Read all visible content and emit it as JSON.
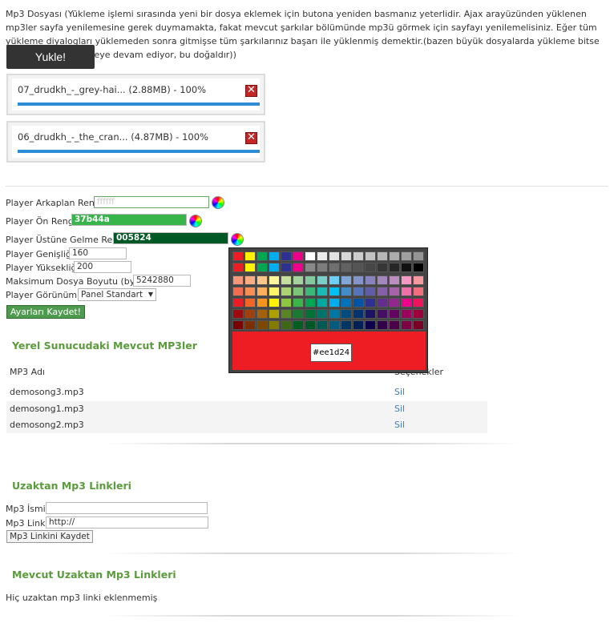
{
  "upload": {
    "description": "Mp3 Dosyası (Yükleme işlemi sırasında yeni bir dosya eklemek için butona yeniden basmanız yeterlidir. Ajax arayüzünden yüklenen mp3ler sayfa yenilemesine gerek duymamakta, fakat mevcut şarkılar bölümünde mp3ü görmek için sayfayı yenilemelisiniz. Eğer tüm yükleme diyalogları yüklemeden sonra gitmişse tüm şarkılarınız başarı ile yüklenmiş demektir.(bazen büyük dosyalarda yükleme bitse bile diyalog gözükmeye devam ediyor, bu doğaldır))",
    "button_label": "Yukle!",
    "files": [
      {
        "name": "07_drudkh_-_grey-hai... (2.88MB) - 100%",
        "progress": 1.0
      },
      {
        "name": "06_drudkh_-_the_cran... (4.87MB) - 100%",
        "progress": 1.0
      }
    ]
  },
  "settings": {
    "bg_color_label": "Player Arkaplan Rengi:",
    "bg_color_value": "ffffff",
    "fg_color_label": "Player Ön Rengi:",
    "fg_color_value": "37b44a",
    "hover_color_label": "Player Üstüne Gelme Rengi:",
    "hover_color_value": "005824",
    "width_label": "Player Genişliği:",
    "width_value": "160",
    "height_label": "Player Yüksekliği:",
    "height_value": "200",
    "max_size_label": "Maksimum Dosya Boyutu (byte):",
    "max_size_value": "5242880",
    "view_label": "Player Görünümü:",
    "view_value": "Panel Standart",
    "save_label": "Ayarları Kaydet!"
  },
  "colors": {
    "fg_bg": "#37b44a",
    "hover_bg": "#005824",
    "accent_green": "#5a9b3c",
    "link_blue": "#3a7fc8"
  },
  "local": {
    "title": "Yerel Sunucudaki Mevcut MP3ler",
    "col_name": "MP3 Adı",
    "col_actions": "Seçenekler",
    "rows": [
      {
        "name": "demosong3.mp3",
        "action": "Sil"
      },
      {
        "name": "demosong1.mp3",
        "action": "Sil"
      },
      {
        "name": "demosong2.mp3",
        "action": "Sil"
      }
    ]
  },
  "remote": {
    "title": "Uzaktan Mp3 Linkleri",
    "name_label": "Mp3 İsmi:",
    "name_value": "",
    "link_label": "Mp3 Linki:",
    "link_value": "http://",
    "save_label": "Mp3 Linkini Kaydet"
  },
  "existing_remote": {
    "title": "Mevcut Uzaktan Mp3 Linkleri",
    "empty_text": "Hiç uzaktan mp3 linki eklenmemiş"
  },
  "picker": {
    "selected_hex": "#ee1d24",
    "top_row": [
      "#ee1d24",
      "#fff200",
      "#00a650",
      "#00aeef",
      "#2f3192",
      "#ed008c",
      "#ffffff",
      "#ebebeb",
      "#e1e1e1",
      "#d7d7d7",
      "#cccccc",
      "#c2c2c2",
      "#b7b7b7",
      "#acacac",
      "#a0a0a0",
      "#959595"
    ],
    "second_row": [
      "#ee1d24",
      "#fff200",
      "#00a650",
      "#00aeef",
      "#2f3192",
      "#ed008c",
      "#898989",
      "#7d7d7d",
      "#707070",
      "#626262",
      "#555555",
      "#464646",
      "#363636",
      "#262626",
      "#111111",
      "#000000"
    ],
    "grid": [
      [
        "#f7977a",
        "#f9ad81",
        "#fdc68a",
        "#fff79a",
        "#c4df9b",
        "#a2d39c",
        "#82ca9d",
        "#7bcdc8",
        "#6ecff6",
        "#7ea7d8",
        "#8493ca",
        "#8882be",
        "#a187be",
        "#bc8dbf",
        "#f49ac2",
        "#f6989d"
      ],
      [
        "#f26c4f",
        "#f68e55",
        "#fbaf5c",
        "#fff467",
        "#acd372",
        "#7cc576",
        "#3bb878",
        "#1abbb4",
        "#00bff3",
        "#438cca",
        "#5574b9",
        "#605ca8",
        "#855fa8",
        "#a763a8",
        "#f06ea9",
        "#f26d7d"
      ],
      [
        "#ed1c24",
        "#f26522",
        "#f7941d",
        "#fff200",
        "#8dc73f",
        "#39b54a",
        "#00a651",
        "#00a99d",
        "#00aeef",
        "#0072bc",
        "#0054a5",
        "#2e3192",
        "#662d91",
        "#92278f",
        "#ec008c",
        "#ed145b"
      ],
      [
        "#9e0b0f",
        "#a0410d",
        "#a36209",
        "#aba000",
        "#598527",
        "#1a7b30",
        "#007236",
        "#00746b",
        "#0076a3",
        "#004b80",
        "#003471",
        "#1b1464",
        "#440e62",
        "#630460",
        "#9e005d",
        "#9e0039"
      ],
      [
        "#790000",
        "#7b2e00",
        "#7d4900",
        "#827b00",
        "#406618",
        "#005e20",
        "#005826",
        "#005952",
        "#005b7f",
        "#003663",
        "#002157",
        "#0d004c",
        "#32004b",
        "#4b0049",
        "#7b0046",
        "#7a0026"
      ]
    ]
  }
}
